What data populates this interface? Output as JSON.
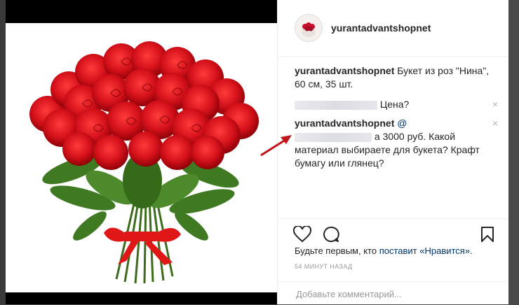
{
  "post": {
    "username": "yurantadvantshopnet",
    "caption_text": "Букет из роз \"Нина\", 60 см, 35 шт.",
    "comments": [
      {
        "username_blurred": true,
        "text": "Цена?"
      },
      {
        "username": "yurantadvantshopnet",
        "mention_prefix": "@",
        "text": "а 3000 руб. Какой материал выбираете для букета? Крафт бумагу или глянец?"
      }
    ],
    "likes_prefix": "Будьте первым, кто ",
    "likes_link": "поставит «Нравится»",
    "likes_suffix": ".",
    "time": "54 МИНУТ НАЗАД",
    "comment_placeholder": "Добавьте комментарий...",
    "close_symbol": "×"
  },
  "colors": {
    "accent": "#003569",
    "arrow": "#c0151b"
  }
}
